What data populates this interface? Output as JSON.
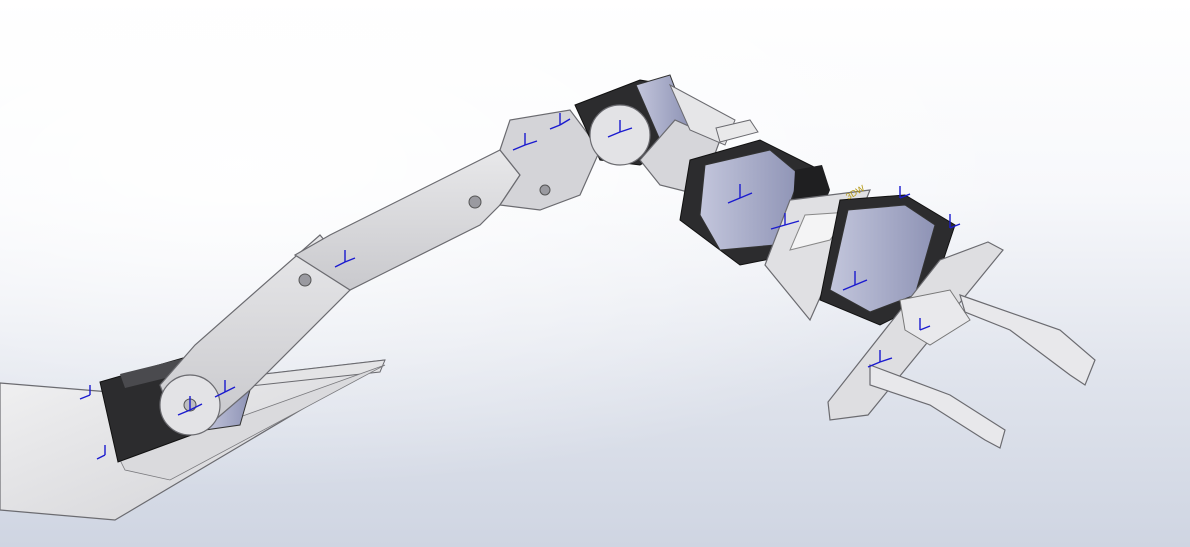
{
  "viewport": {
    "background_top": "#ffffff",
    "background_bottom": "#cfd5e2"
  },
  "model": {
    "description_icon": "robotic-arm-assembly",
    "part_fill": "#dcdcde",
    "part_stroke": "#6b6b70",
    "servo_body": "#2c2c2e",
    "servo_face": "#a9adc8",
    "triad_color": "#1a1acf",
    "annotation_color": "#b59a14"
  },
  "annotation": {
    "text": "3DW"
  }
}
